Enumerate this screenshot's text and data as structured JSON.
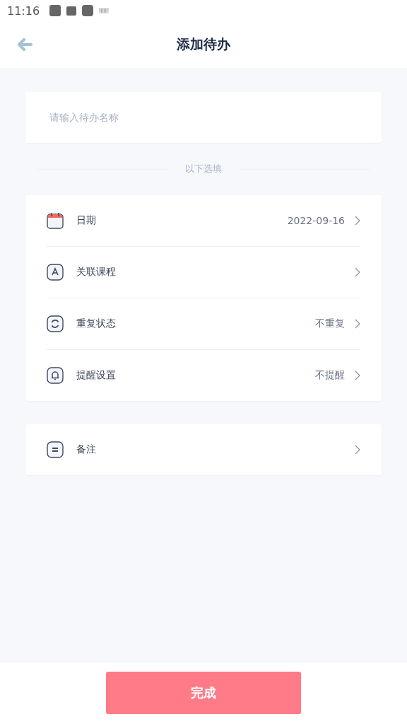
{
  "status_bar": {
    "time": "11:16"
  },
  "header": {
    "title": "添加待办"
  },
  "name_field": {
    "placeholder": "请输入待办名称"
  },
  "divider_label": "以下选填",
  "options": [
    {
      "kind": "calendar",
      "label": "日期",
      "value": "2022-09-16"
    },
    {
      "kind": "course",
      "label": "关联课程"
    },
    {
      "kind": "repeat",
      "label": "重复状态",
      "value": "不重复"
    },
    {
      "kind": "reminder",
      "label": "提醒设置",
      "value": "不提醒"
    }
  ],
  "notes": [
    {
      "kind": "notes",
      "label": "备注"
    }
  ],
  "done_button": "完成"
}
